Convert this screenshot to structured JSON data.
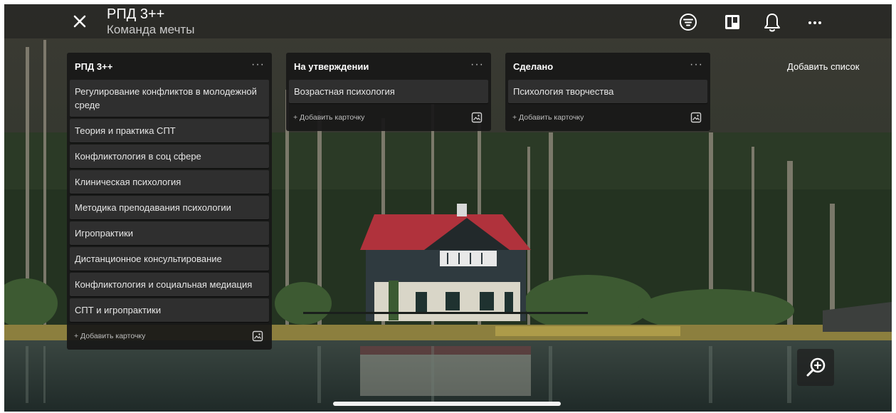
{
  "header": {
    "title": "РПД 3++",
    "subtitle": "Команда мечты",
    "icons": [
      "close-icon",
      "filter-icon",
      "board-view-icon",
      "bell-icon",
      "more-icon"
    ]
  },
  "lists": [
    {
      "title": "РПД 3++",
      "menu": "···",
      "cards": [
        "Регулирование конфликтов в молодежной среде",
        "Теория и практика СПТ",
        "Конфликтология в соц сфере",
        "Клиническая психология",
        "Методика преподавания психологии",
        "Игропрактики",
        "Дистанционное консультирование",
        "Конфликтология и социальная медиация",
        "СПТ и игропрактики"
      ],
      "add_card": "+ Добавить карточку"
    },
    {
      "title": "На утверждении",
      "menu": "···",
      "cards": [
        "Возрастная психология"
      ],
      "add_card": "+ Добавить карточку"
    },
    {
      "title": "Сделано",
      "menu": "···",
      "cards": [
        "Психология творчества"
      ],
      "add_card": "+ Добавить карточку"
    }
  ],
  "add_list": "Добавить список",
  "colors": {
    "list_bg": "#181818",
    "card_bg": "#2f2f2f",
    "roof": "#b0323c",
    "forest": "#2a3326",
    "water": "#2c3a3a"
  }
}
